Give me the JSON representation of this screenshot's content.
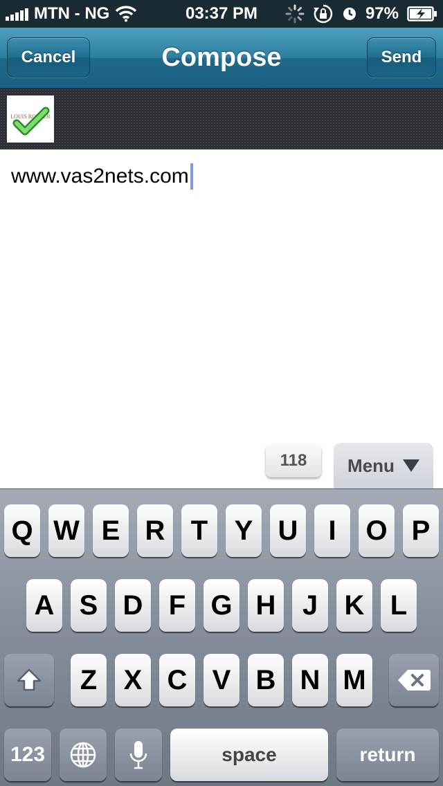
{
  "status_bar": {
    "carrier": "MTN - NG",
    "time": "03:37 PM",
    "battery": "97%"
  },
  "nav": {
    "title": "Compose",
    "cancel_label": "Cancel",
    "send_label": "Send"
  },
  "attachment": {
    "logo_text": "LOUIS ROEDER"
  },
  "message": {
    "text": "www.vas2nets.com"
  },
  "counter": "118",
  "menu_label": "Menu",
  "keyboard": {
    "row1": [
      "Q",
      "W",
      "E",
      "R",
      "T",
      "Y",
      "U",
      "I",
      "O",
      "P"
    ],
    "row2": [
      "A",
      "S",
      "D",
      "F",
      "G",
      "H",
      "J",
      "K",
      "L"
    ],
    "row3": [
      "Z",
      "X",
      "C",
      "V",
      "B",
      "N",
      "M"
    ],
    "numbers_label": "123",
    "space_label": "space",
    "return_label": "return"
  }
}
